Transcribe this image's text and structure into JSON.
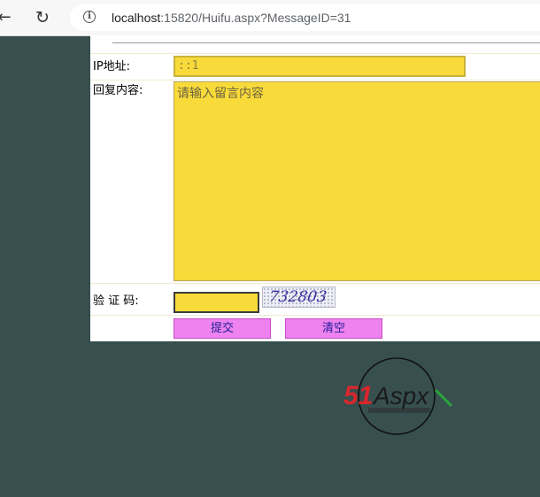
{
  "browser": {
    "url_host": "localhost",
    "url_rest": ":15820/Huifu.aspx?MessageID=31"
  },
  "form": {
    "ip_label": "IP地址:",
    "ip_value": "::1",
    "reply_label": "回复内容:",
    "reply_placeholder": "请输入留言内容",
    "captcha_label": "验 证 码:",
    "captcha_value": "",
    "captcha_code": "732803",
    "submit_label": "提交",
    "clear_label": "清空"
  },
  "logo": {
    "brand_num": "51",
    "brand_text": "Aspx",
    "brand_color_red": "#d9262c",
    "brand_color_green": "#2aa53a"
  }
}
